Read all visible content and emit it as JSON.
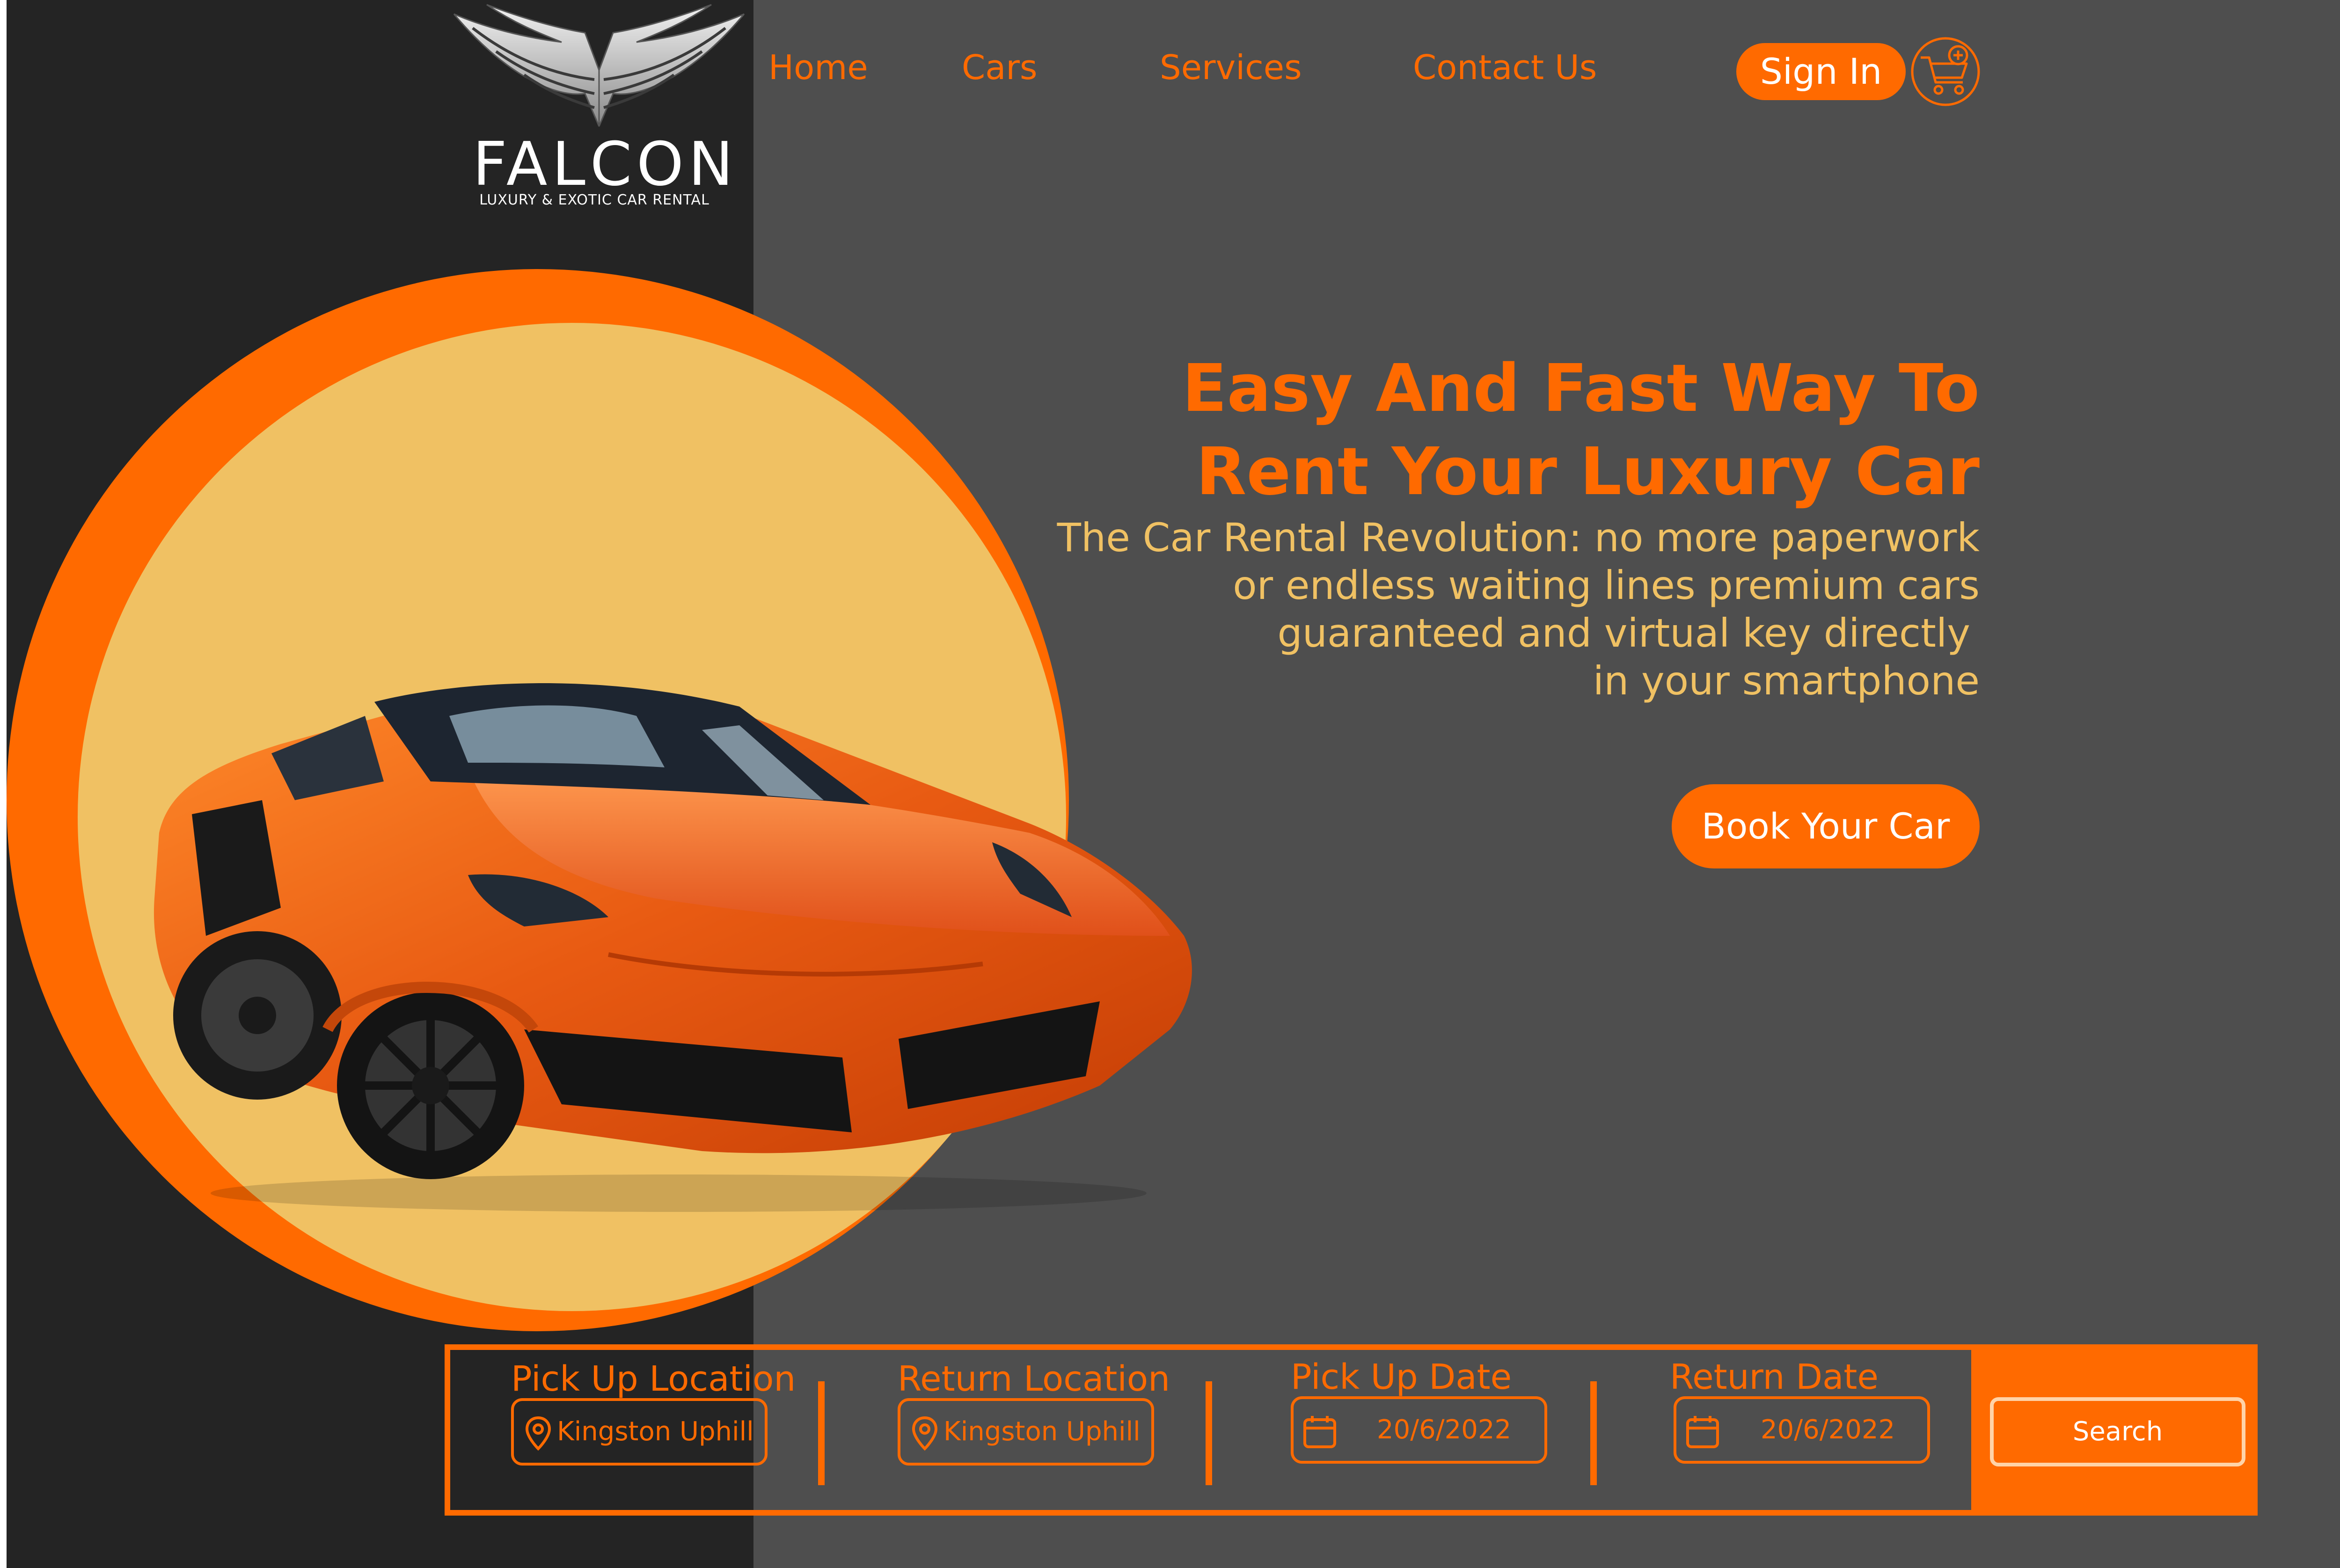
{
  "brand": {
    "name": "FALCON",
    "tagline": "LUXURY & EXOTIC CAR RENTAL"
  },
  "nav": {
    "items": [
      "Home",
      "Cars",
      "Services",
      "Contact Us"
    ],
    "sign_in": "Sign In",
    "cart_icon": "cart-plus-icon"
  },
  "hero": {
    "headline": [
      "Easy And Fast Way To",
      "Rent Your Luxury Car"
    ],
    "subtext": [
      "The Car Rental Revolution: no more paperwork",
      "or endless waiting lines premium cars",
      "guaranteed and virtual key directly",
      "in your smartphone"
    ],
    "cta": "Book Your Car"
  },
  "search": {
    "fields": [
      {
        "label": "Pick Up Location",
        "value": "Kingston Uphill",
        "icon": "location-pin-icon"
      },
      {
        "label": "Return Location",
        "value": "Kingston Uphill",
        "icon": "location-pin-icon"
      },
      {
        "label": "Pick Up Date",
        "value": "20/6/2022",
        "icon": "calendar-icon"
      },
      {
        "label": "Return Date",
        "value": "20/6/2022",
        "icon": "calendar-icon"
      }
    ],
    "button": "Search"
  },
  "colors": {
    "accent": "#ff6a00",
    "accent_soft": "#f0c163",
    "dark_panel": "#242424",
    "grey_panel": "#4e4e4e"
  }
}
